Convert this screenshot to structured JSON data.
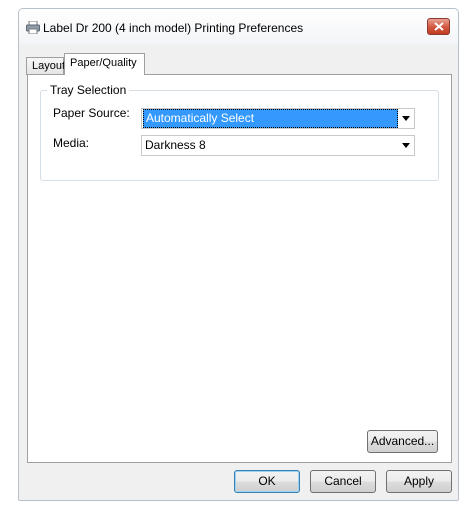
{
  "window": {
    "title": "Label Dr 200 (4 inch model) Printing Preferences"
  },
  "tabs": [
    {
      "label": "Layout",
      "active": false
    },
    {
      "label": "Paper/Quality",
      "active": true
    }
  ],
  "tray_selection": {
    "legend": "Tray Selection",
    "paper_source": {
      "label": "Paper Source:",
      "value": "Automatically Select"
    },
    "media": {
      "label": "Media:",
      "value": "Darkness 8"
    }
  },
  "buttons": {
    "advanced": "Advanced...",
    "ok": "OK",
    "cancel": "Cancel",
    "apply": "Apply"
  },
  "colors": {
    "selection_highlight": "#3399ff",
    "close_button": "#c74a32"
  }
}
